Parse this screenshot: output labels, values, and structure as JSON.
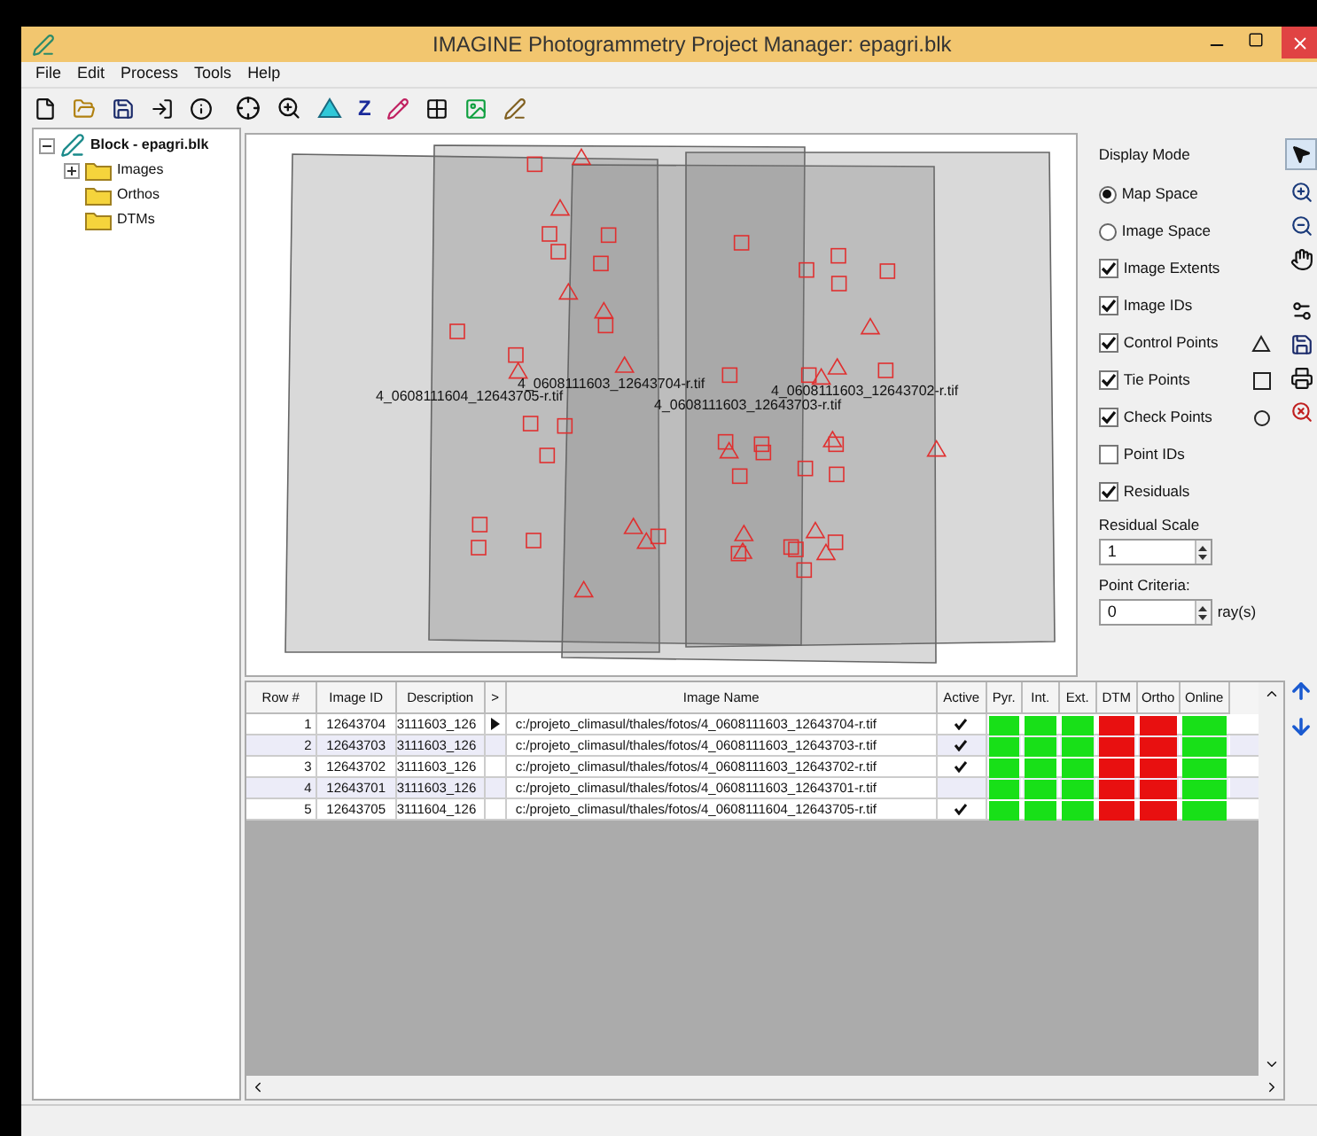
{
  "window": {
    "title": "IMAGINE Photogrammetry Project Manager: epagri.blk"
  },
  "menu": [
    "File",
    "Edit",
    "Process",
    "Tools",
    "Help"
  ],
  "toolbar": {
    "z_glyph": "Z"
  },
  "tree": {
    "label": "Block - epagri.blk",
    "expanded": true,
    "children": [
      {
        "label": "Images",
        "expanded": false
      },
      {
        "label": "Orthos"
      },
      {
        "label": "DTMs"
      }
    ]
  },
  "canvas": {
    "image_labels": [
      "4_0608111604_12643705-r.tif",
      "4_0608111603_12643704-r.tif",
      "4_0608111603_12643703-r.tif",
      "4_0608111603_12643702-r.tif"
    ]
  },
  "display": {
    "title": "Display Mode",
    "modes": [
      {
        "label": "Map Space",
        "selected": true
      },
      {
        "label": "Image Space",
        "selected": false
      }
    ],
    "options": [
      {
        "label": "Image Extents",
        "checked": true,
        "kind": "plain"
      },
      {
        "label": "Image IDs",
        "checked": true,
        "kind": "plain"
      },
      {
        "label": "Control Points",
        "checked": true,
        "kind": "triangle"
      },
      {
        "label": "Tie Points",
        "checked": true,
        "kind": "square"
      },
      {
        "label": "Check Points",
        "checked": true,
        "kind": "circle"
      },
      {
        "label": "Point IDs",
        "checked": false,
        "kind": "plain"
      },
      {
        "label": "Residuals",
        "checked": true,
        "kind": "plain"
      }
    ],
    "residual_scale": {
      "label": "Residual Scale",
      "value": "1"
    },
    "point_criteria": {
      "label": "Point Criteria:",
      "value": "0",
      "unit": "ray(s)"
    }
  },
  "table": {
    "columns": [
      "Row #",
      "Image ID",
      "Description",
      ">",
      "Image Name",
      "Active",
      "Pyr.",
      "Int.",
      "Ext.",
      "DTM",
      "Ortho",
      "Online"
    ],
    "rows": [
      {
        "row": "1",
        "image_id": "12643704",
        "description": "3111603_126",
        "current": true,
        "image_name": "c:/projeto_climasul/thales/fotos/4_0608111603_12643704-r.tif",
        "active": true,
        "pyr": true,
        "int": true,
        "ext": true,
        "dtm": false,
        "ortho": false,
        "online": true
      },
      {
        "row": "2",
        "image_id": "12643703",
        "description": "3111603_126",
        "current": false,
        "image_name": "c:/projeto_climasul/thales/fotos/4_0608111603_12643703-r.tif",
        "active": true,
        "pyr": true,
        "int": true,
        "ext": true,
        "dtm": false,
        "ortho": false,
        "online": true
      },
      {
        "row": "3",
        "image_id": "12643702",
        "description": "3111603_126",
        "current": false,
        "image_name": "c:/projeto_climasul/thales/fotos/4_0608111603_12643702-r.tif",
        "active": true,
        "pyr": true,
        "int": true,
        "ext": true,
        "dtm": false,
        "ortho": false,
        "online": true
      },
      {
        "row": "4",
        "image_id": "12643701",
        "description": "3111603_126",
        "current": false,
        "image_name": "c:/projeto_climasul/thales/fotos/4_0608111603_12643701-r.tif",
        "active": false,
        "pyr": true,
        "int": true,
        "ext": true,
        "dtm": false,
        "ortho": false,
        "online": true
      },
      {
        "row": "5",
        "image_id": "12643705",
        "description": "3111604_126",
        "current": false,
        "image_name": "c:/projeto_climasul/thales/fotos/4_0608111604_12643705-r.tif",
        "active": true,
        "pyr": true,
        "int": true,
        "ext": true,
        "dtm": false,
        "ortho": false,
        "online": true
      }
    ]
  }
}
